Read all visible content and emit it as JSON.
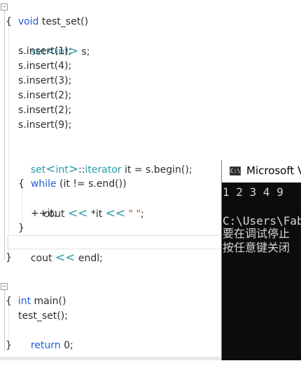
{
  "editor": {
    "lines": {
      "l1": {
        "kw": "void",
        "rest": " test_set()"
      },
      "l2": "{",
      "l3": {
        "type": "set",
        "op1": "<",
        "type2": "int",
        "op2": ">",
        "rest": " s;"
      },
      "l4": "s.insert(1);",
      "l5": "s.insert(4);",
      "l6": "s.insert(3);",
      "l7": "s.insert(2);",
      "l8": "s.insert(2);",
      "l9": "s.insert(9);",
      "l10": {
        "type": "set",
        "op1": "<",
        "type2": "int",
        "op2": ">",
        "sep": "::",
        "iter": "iterator",
        "rest": " it = s.begin();"
      },
      "l11": {
        "kw": "while",
        "rest": " (it != s.end())"
      },
      "l12": "{",
      "l13": {
        "a": "cout ",
        "op1": "<<",
        "b": " *it ",
        "op2": "<<",
        "str": " \" \"",
        "end": ";"
      },
      "l14": "++it;",
      "l15": "}",
      "l16": {
        "a": "cout ",
        "op": "<<",
        "b": " endl;"
      },
      "l17": "}",
      "l18": {
        "kw": "int",
        "rest": " main()"
      },
      "l19": "{",
      "l20": "test_set();",
      "l21": {
        "kw": "return",
        "rest": " 0;"
      },
      "l22": "}"
    },
    "fold_symbol": "−"
  },
  "console": {
    "icon_text": "C:\\",
    "title": "Microsoft Visual Studio Debug Console",
    "output_line": "1 2 3 4 9",
    "path_line": "C:\\Users\\Fab",
    "msg_line1": "要在调试停止",
    "msg_line2": "按任意键关闭"
  }
}
